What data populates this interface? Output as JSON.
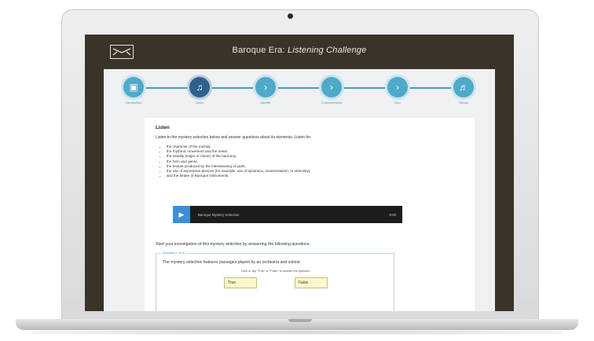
{
  "app": {
    "title_plain": "Baroque Era: ",
    "title_italic": "Listening Challenge"
  },
  "stepper": {
    "steps": [
      {
        "label": "Introduction",
        "icon": "document-icon",
        "glyph": "▣"
      },
      {
        "label": "Listen",
        "icon": "playlist-icon",
        "glyph": "♫"
      },
      {
        "label": "Identify",
        "icon": "chevron-right-icon",
        "glyph": "›"
      },
      {
        "label": "Characteristics",
        "icon": "chevron-right-icon",
        "glyph": "›"
      },
      {
        "label": "Quiz",
        "icon": "chevron-right-icon",
        "glyph": "›"
      },
      {
        "label": "Recap",
        "icon": "music-note-icon",
        "glyph": "♬"
      }
    ],
    "active_index": 1
  },
  "card": {
    "heading": "Listen",
    "intro": "Listen to the mystery selection below and answer questions about its elements. Listen for:",
    "bullets": [
      "the character of the melody,",
      "the rhythmic movement and the meter,",
      "the tonality (major or minor) of the harmony,",
      "the form and genre,",
      "the texture produced by the interweaving of parts,",
      "the use of expressive devices (for example, use of dynamics, ornamentation, or virtuosity),",
      "and the timbre of Baroque instruments."
    ]
  },
  "player": {
    "track": "Baroque Mystery Selection",
    "time": "0:00",
    "play_glyph": "▶"
  },
  "prompt": "Start your investigation of this mystery selection by answering the following questions.",
  "question": {
    "label": "Question 1 of 5",
    "text": "The mystery selection features passages played by an orchestra and soloist.",
    "instruction": "Click or tap \"True\" or \"False\" to answer the question.",
    "options": [
      "True",
      "False"
    ]
  },
  "colors": {
    "header_bg": "#3a3327",
    "step_accent": "#4fa9c8",
    "step_active": "#2f5f8f",
    "play_button": "#3b8fd6",
    "answer_bg": "#fbf7cf"
  }
}
